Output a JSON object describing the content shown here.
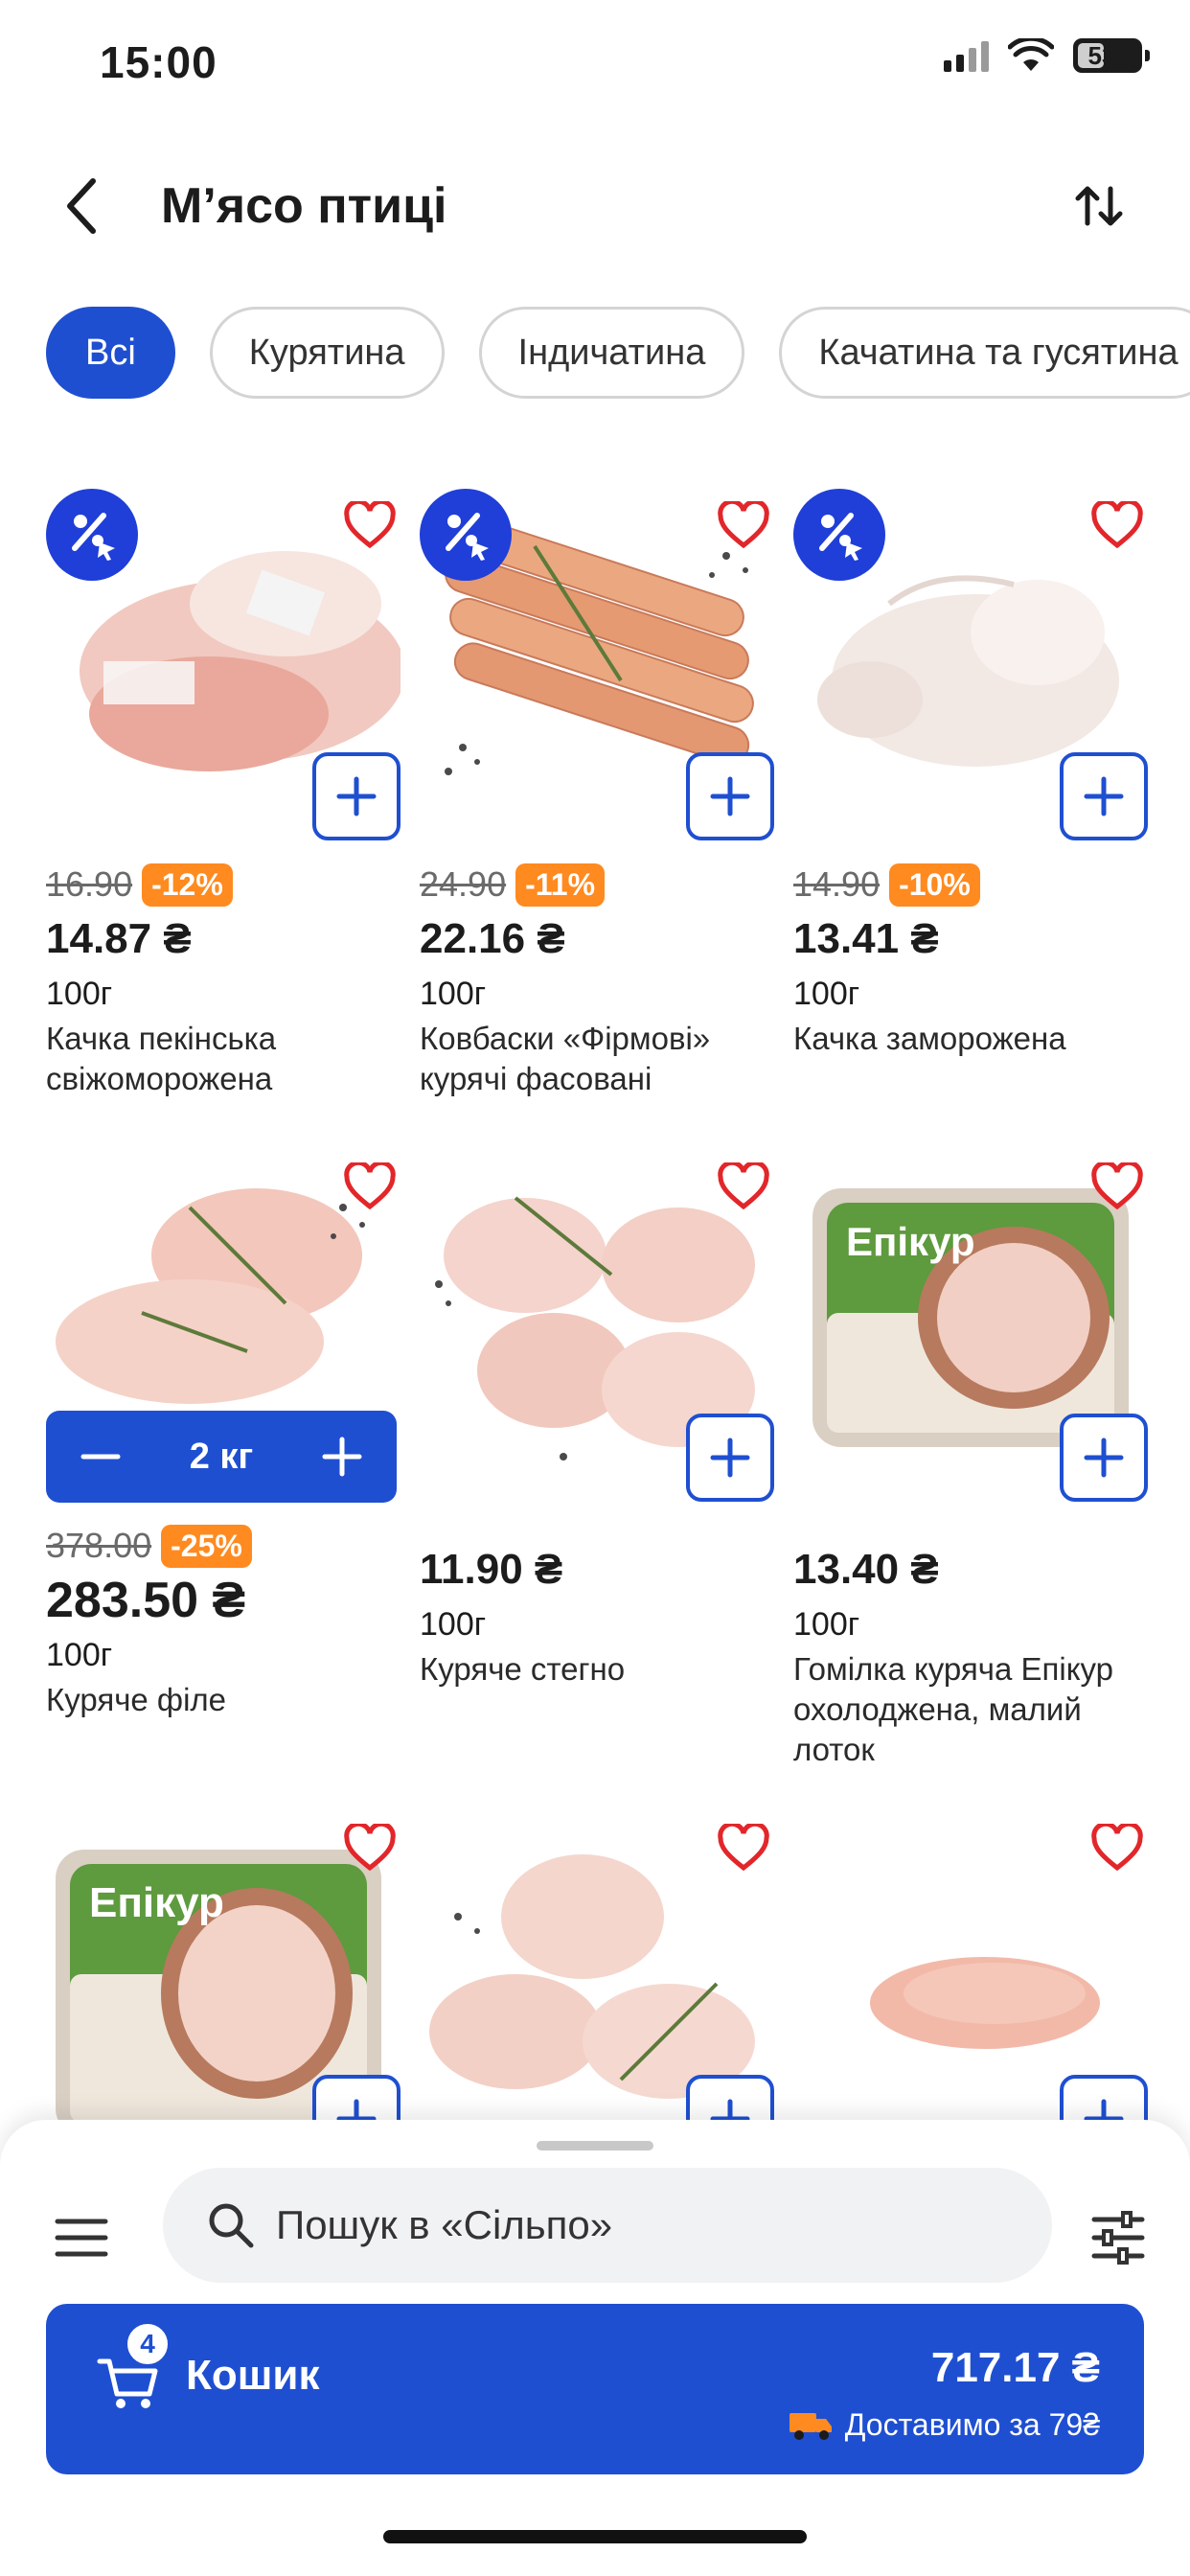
{
  "status_bar": {
    "time": "15:00",
    "battery": "53",
    "battery_level": 0.53,
    "signal_icon": "cellular-signal-icon",
    "wifi_icon": "wifi-icon",
    "battery_icon": "battery-icon"
  },
  "header": {
    "title": "М’ясо птиці",
    "back_icon": "chevron-left-icon",
    "sort_icon": "sort-arrows-icon"
  },
  "chips": [
    {
      "label": "Всі",
      "active": true
    },
    {
      "label": "Курятина",
      "active": false
    },
    {
      "label": "Індичатина",
      "active": false
    },
    {
      "label": "Качатина та гусятина",
      "active": false
    }
  ],
  "products": [
    {
      "old_price": "16.90",
      "discount": "-12%",
      "price": "14.87 ₴",
      "weight": "100г",
      "name_line1": "Качка пекінська",
      "name_line2": "свіжоморожена"
    },
    {
      "old_price": "24.90",
      "discount": "-11%",
      "price": "22.16 ₴",
      "weight": "100г",
      "name_line1": "Ковбаски «Фірмові»",
      "name_line2": "курячі фасовані"
    },
    {
      "old_price": "14.90",
      "discount": "-10%",
      "price": "13.41 ₴",
      "weight": "100г",
      "name_line1": "Качка заморожена",
      "name_line2": ""
    },
    {
      "old_price": "378.00",
      "discount": "-25%",
      "price": "283.50 ₴",
      "weight": "100г",
      "name_line1": "Куряче філе",
      "name_line2": "",
      "quantity": "2 кг"
    },
    {
      "price": "11.90 ₴",
      "weight": "100г",
      "name_line1": "Куряче стегно",
      "name_line2": ""
    },
    {
      "price": "13.40 ₴",
      "weight": "100г",
      "name_line1": "Гомілка куряча Епікур",
      "name_line2": "охолоджена, малий",
      "name_line3": "лоток"
    },
    {
      "brand": "Епікур"
    },
    {},
    {}
  ],
  "brand_labels": {
    "epikur": "Епікур"
  },
  "bottom_bar": {
    "search_placeholder": "Пошук в «Сільпо»",
    "cart_label": "Кошик",
    "cart_count": "4",
    "cart_total": "717.17 ₴",
    "delivery_text": "Доставимо за 79₴"
  },
  "colors": {
    "accent": "#1f4fd1",
    "discount_badge": "#ff8a1f",
    "discount_icon_bg": "#1f3fd8",
    "favorite": "#e2262a"
  }
}
